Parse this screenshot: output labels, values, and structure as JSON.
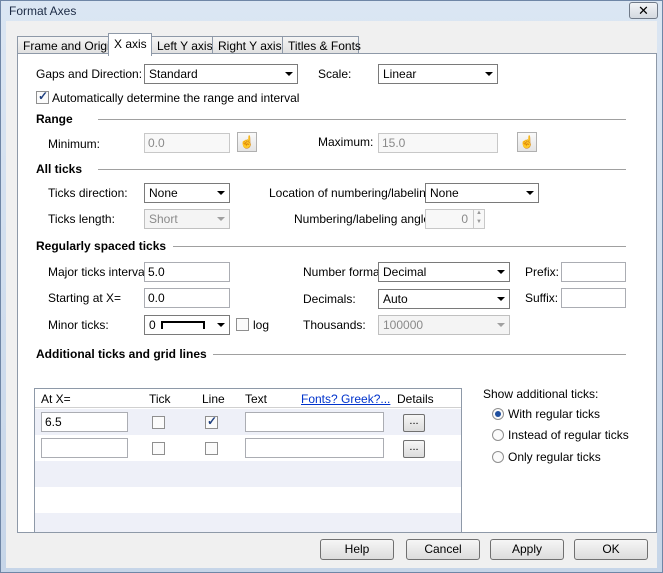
{
  "window": {
    "title": "Format Axes",
    "close_glyph": "✕"
  },
  "tabs": [
    {
      "label": "Frame and Origin"
    },
    {
      "label": "X axis"
    },
    {
      "label": "Left Y axis"
    },
    {
      "label": "Right Y axis"
    },
    {
      "label": "Titles & Fonts"
    }
  ],
  "gaps": {
    "label": "Gaps and Direction:",
    "value": "Standard"
  },
  "scale": {
    "label": "Scale:",
    "value": "Linear"
  },
  "auto_range": {
    "label": "Automatically determine the range and interval",
    "checked": true
  },
  "range": {
    "heading": "Range",
    "min_label": "Minimum:",
    "min_value": "0.0",
    "max_label": "Maximum:",
    "max_value": "15.0"
  },
  "all_ticks": {
    "heading": "All ticks",
    "direction_label": "Ticks direction:",
    "direction_value": "None",
    "length_label": "Ticks length:",
    "length_value": "Short",
    "location_label": "Location of numbering/labeling:",
    "location_value": "None",
    "angle_label": "Numbering/labeling angle:",
    "angle_value": "0"
  },
  "regular": {
    "heading": "Regularly spaced ticks",
    "major_label": "Major ticks interval:",
    "major_value": "5.0",
    "start_label": "Starting at X=",
    "start_value": "0.0",
    "minor_label": "Minor ticks:",
    "minor_value": "0",
    "log_label": "log",
    "number_format_label": "Number format:",
    "number_format_value": "Decimal",
    "decimals_label": "Decimals:",
    "decimals_value": "Auto",
    "thousands_label": "Thousands:",
    "thousands_value": "100000",
    "prefix_label": "Prefix:",
    "prefix_value": "",
    "suffix_label": "Suffix:",
    "suffix_value": ""
  },
  "additional": {
    "heading": "Additional ticks and grid lines",
    "columns": {
      "at": "At X=",
      "tick": "Tick",
      "line": "Line",
      "text": "Text",
      "fonts_link": "Fonts? Greek?...",
      "details": "Details"
    },
    "rows": [
      {
        "at": "6.5",
        "tick": false,
        "line": true,
        "text": "",
        "details": "..."
      },
      {
        "at": "",
        "tick": false,
        "line": false,
        "text": "",
        "details": "..."
      }
    ],
    "show_label": "Show additional ticks:",
    "options": [
      {
        "label": "With regular ticks",
        "selected": true
      },
      {
        "label": "Instead of regular ticks",
        "selected": false
      },
      {
        "label": "Only regular ticks",
        "selected": false
      }
    ]
  },
  "buttons": {
    "help": "Help",
    "cancel": "Cancel",
    "apply": "Apply",
    "ok": "OK"
  }
}
